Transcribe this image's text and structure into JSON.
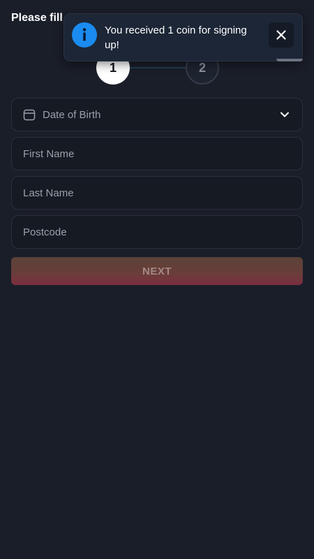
{
  "header": {
    "title": "Please fill"
  },
  "toast": {
    "message": "You received 1 coin for signing up!",
    "icon": "info-icon",
    "close_icon": "close-icon",
    "accent": "#1a8bf0"
  },
  "stepper": {
    "current_step": 1,
    "steps": [
      {
        "label": "1",
        "active": true
      },
      {
        "label": "2",
        "active": false
      }
    ]
  },
  "form": {
    "dob": {
      "placeholder": "Date of Birth",
      "icon": "calendar-icon",
      "dropdown_icon": "chevron-down-icon"
    },
    "first_name": {
      "placeholder": "First Name",
      "value": ""
    },
    "last_name": {
      "placeholder": "Last Name",
      "value": ""
    },
    "postcode": {
      "placeholder": "Postcode",
      "value": ""
    },
    "next_label": "NEXT"
  },
  "colors": {
    "background": "#1a1e29",
    "field_border": "#2a303c",
    "placeholder": "#9aa0aa"
  }
}
